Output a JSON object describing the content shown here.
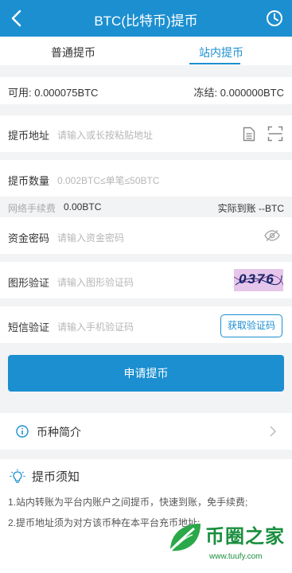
{
  "header": {
    "title": "BTC(比特币)提币",
    "back_icon": "back-arrow-icon",
    "history_icon": "history-clock-icon"
  },
  "tabs": [
    {
      "label": "普通提币",
      "active": false
    },
    {
      "label": "站内提币",
      "active": true
    }
  ],
  "balance": {
    "available": "可用: 0.000075BTC",
    "frozen": "冻结: 0.000000BTC"
  },
  "address": {
    "label": "提币地址",
    "placeholder": "请输入或长按粘贴地址"
  },
  "amount": {
    "label": "提币数量",
    "placeholder": "0.002BTC≤单笔≤50BTC"
  },
  "fee": {
    "label": "网络手续费",
    "value": "0.00BTC",
    "actual": "实际到账 --BTC"
  },
  "fund_password": {
    "label": "资金密码",
    "placeholder": "请输入资金密码"
  },
  "captcha": {
    "label": "图形验证",
    "placeholder": "请输入图形验证码",
    "image_text": "0376"
  },
  "sms": {
    "label": "短信验证",
    "placeholder": "请输入手机验证码",
    "button": "获取验证码"
  },
  "submit_button": "申请提币",
  "coin_intro": {
    "label": "币种简介"
  },
  "notes": {
    "title": "提币须知",
    "items": [
      "1.站内转账为平台内账户之间提币，快速到账，免手续费;",
      "2.提币地址须为对方该币种在本平台充币地址;"
    ]
  },
  "watermark": {
    "name": "币圈之家",
    "url": "www.tuufy.com"
  },
  "colors": {
    "primary": "#1c8fd1",
    "background": "#f2f3f5",
    "watermark": "#1a8f3e"
  }
}
